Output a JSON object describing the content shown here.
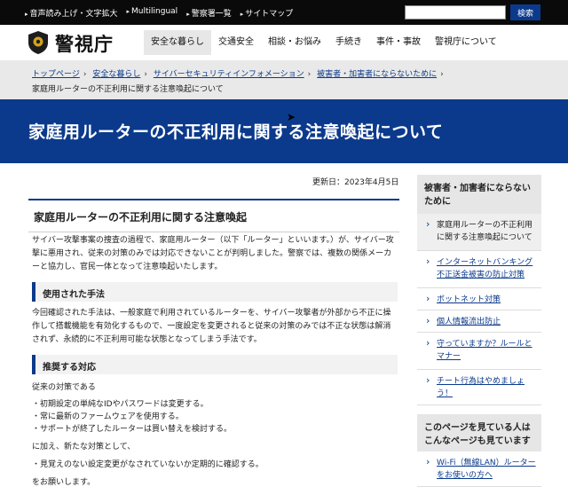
{
  "topbar": {
    "links": [
      "音声読み上げ・文字拡大",
      "Multilingual",
      "警察署一覧",
      "サイトマップ"
    ],
    "search_placeholder": "",
    "search_button": "検索"
  },
  "header": {
    "logo_text": "警視庁",
    "nav": [
      "安全な暮らし",
      "交通安全",
      "相談・お悩み",
      "手続き",
      "事件・事故",
      "警視庁について"
    ]
  },
  "breadcrumb": {
    "links": [
      "トップページ",
      "安全な暮らし",
      "サイバーセキュリティインフォメーション",
      "被害者・加害者にならないために"
    ],
    "current": "家庭用ルーターの不正利用に関する注意喚起について"
  },
  "banner_title": "家庭用ルーターの不正利用に関する注意喚起について",
  "main": {
    "updated": "更新日：2023年4月5日",
    "title": "家庭用ルーターの不正利用に関する注意喚起",
    "intro": "サイバー攻撃事案の捜査の過程で、家庭用ルーター（以下「ルーター」といいます。）が、サイバー攻撃に悪用され、従来の対策のみでは対応できないことが判明しました。警察では、複数の関係メーカーと協力し、官民一体となって注意喚起いたします。",
    "section1": {
      "heading": "使用された手法",
      "body": "今回確認された手法は、一般家庭で利用されているルーターを、サイバー攻撃者が外部から不正に操作して搭載機能を有効化するもので、一度設定を変更されると従来の対策のみでは不正な状態は解消されず、永続的に不正利用可能な状態となってしまう手法です。"
    },
    "section2": {
      "heading": "推奨する対応",
      "lead": "従来の対策である",
      "bullets": [
        "初期設定の単純なIDやパスワードは変更する。",
        "常に最新のファームウェアを使用する。",
        "サポートが終了したルーターは買い替えを検討する。"
      ],
      "mid": "に加え、新たな対策として、",
      "bullets2": [
        "見覚えのない設定変更がなされていないか定期的に確認する。"
      ],
      "closing": "をお願いします。"
    }
  },
  "sidebar": {
    "heading": "被害者・加害者にならないために",
    "items": [
      "家庭用ルーターの不正利用に関する注意喚起について",
      "インターネットバンキング不正送金被害の防止対策",
      "ボットネット対策",
      "個人情報流出防止",
      "守っていますか？ルールとマナー",
      "チート行為はやめましょう！"
    ],
    "related_heading": "このページを見ている人はこんなページも見ています",
    "related_items": [
      "Wi-Fi（無線LAN）ルーターをお使いの方へ"
    ]
  }
}
